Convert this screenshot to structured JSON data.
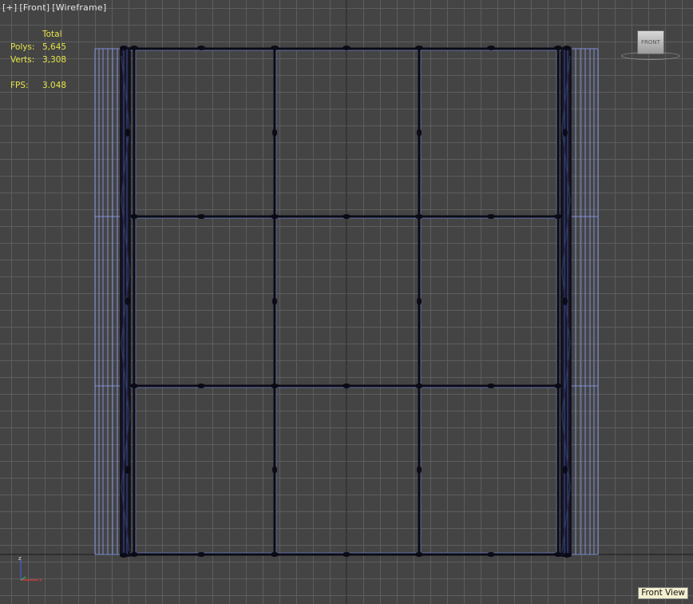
{
  "viewport": {
    "label": {
      "plus": "[+]",
      "view": "[Front]",
      "shading": "[Wireframe]"
    },
    "stats": {
      "header": "Total",
      "rows": [
        {
          "key": "Polys:",
          "value": "5,645"
        },
        {
          "key": "Verts:",
          "value": "3,308"
        }
      ],
      "fps_key": "FPS:",
      "fps_value": "3.048"
    },
    "viewcube": {
      "face_label": "FRONT"
    },
    "view_tag": "Front View"
  },
  "colors": {
    "viewport_bg": "#444444",
    "grid_line": "#5f5f5f",
    "stats_text": "#e6e44a",
    "wire_frame": "#0b0b16",
    "wire_highlight": "#8fa6ff"
  },
  "icons": [
    "world-axis-gizmo-icon",
    "viewcube-icon"
  ]
}
